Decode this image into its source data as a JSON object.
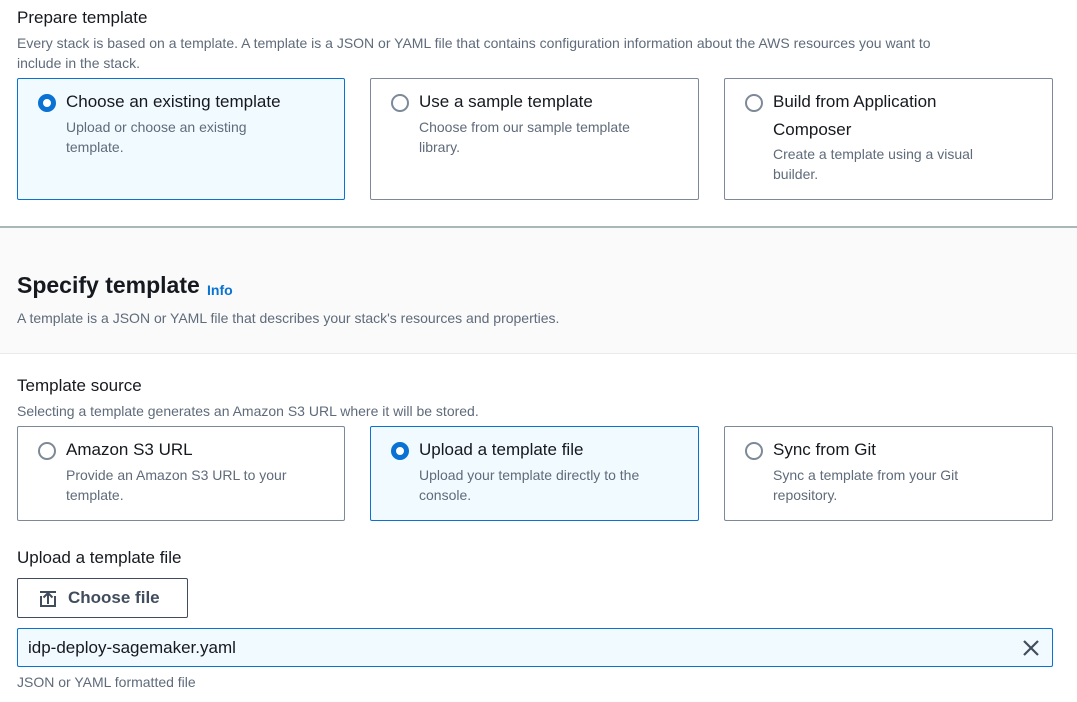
{
  "prepare": {
    "label": "Prepare template",
    "description_line1": "Every stack is based on a template. A template is a JSON or YAML file that contains configuration information about the AWS resources you want to",
    "description_line2": "include in the stack.",
    "options": [
      {
        "title": "Choose an existing template",
        "desc1": "Upload or choose an existing",
        "desc2": "template.",
        "selected": true
      },
      {
        "title": "Use a sample template",
        "desc1": "Choose from our sample template",
        "desc2": "library.",
        "selected": false
      },
      {
        "title1": "Build from Application",
        "title2": "Composer",
        "desc1": "Create a template using a visual",
        "desc2": "builder.",
        "selected": false
      }
    ]
  },
  "specify": {
    "heading": "Specify template",
    "info": "Info",
    "description": "A template is a JSON or YAML file that describes your stack's resources and properties."
  },
  "source": {
    "label": "Template source",
    "description": "Selecting a template generates an Amazon S3 URL where it will be stored.",
    "options": [
      {
        "title": "Amazon S3 URL",
        "desc1": "Provide an Amazon S3 URL to your",
        "desc2": "template.",
        "selected": false
      },
      {
        "title": "Upload a template file",
        "desc1": "Upload your template directly to the",
        "desc2": "console.",
        "selected": true
      },
      {
        "title": "Sync from Git",
        "desc1": "Sync a template from your Git",
        "desc2": "repository.",
        "selected": false
      }
    ]
  },
  "upload": {
    "label": "Upload a template file",
    "button": "Choose file",
    "button_icon": "upload-icon",
    "file_name": "idp-deploy-sagemaker.yaml",
    "clear_icon": "close-icon",
    "hint": "JSON or YAML formatted file"
  },
  "colors": {
    "accent": "#0972d3",
    "selected_bg": "#f1faff",
    "text": "#16191f",
    "muted": "#5f6b7a"
  }
}
